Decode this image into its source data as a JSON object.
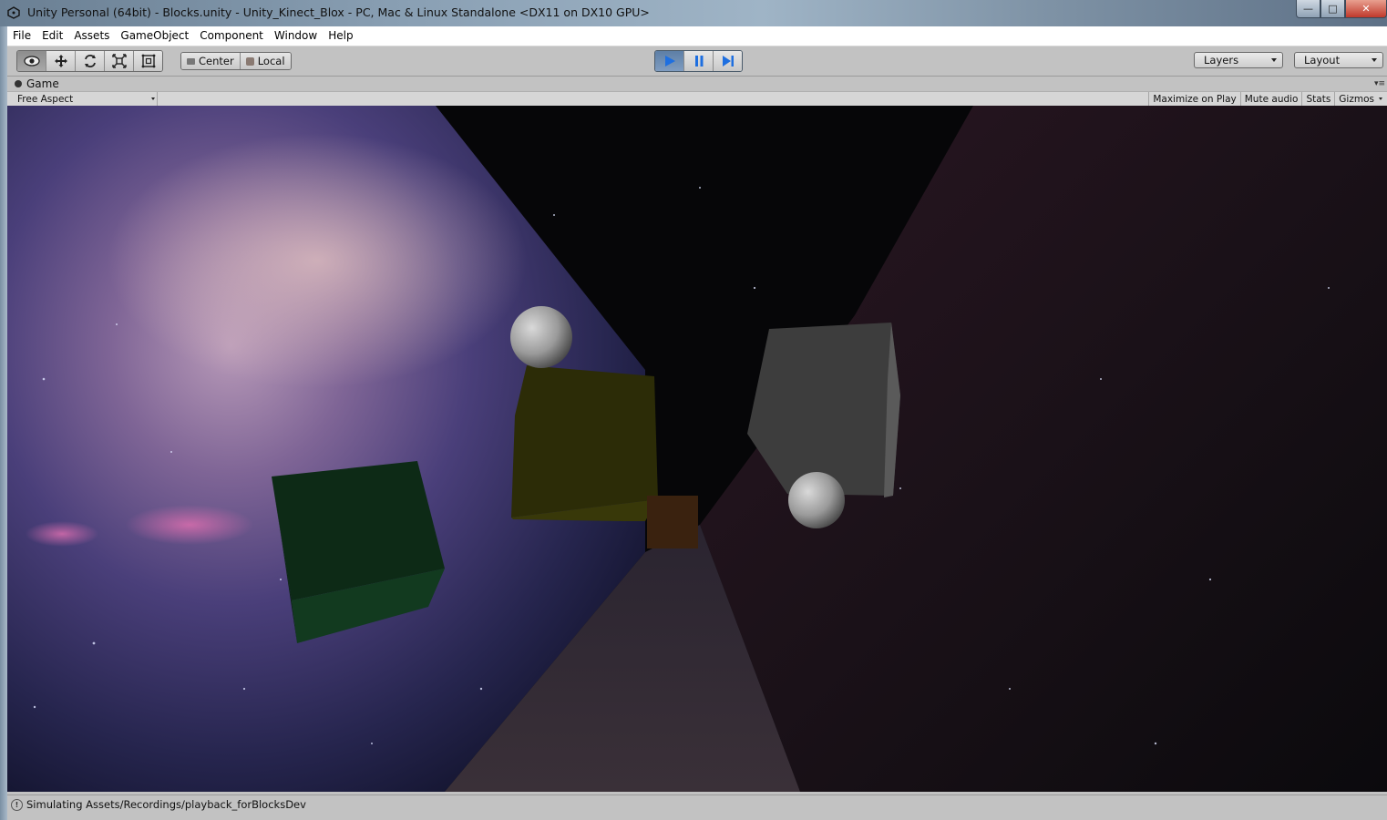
{
  "window": {
    "title": "Unity Personal (64bit) - Blocks.unity - Unity_Kinect_Blox - PC, Mac & Linux Standalone <DX11 on DX10 GPU>",
    "controls": {
      "minimize": "—",
      "maximize": "□",
      "close": "✕"
    }
  },
  "menu": [
    "File",
    "Edit",
    "Assets",
    "GameObject",
    "Component",
    "Window",
    "Help"
  ],
  "toolbar": {
    "tools": [
      "hand-tool",
      "move-tool",
      "rotate-tool",
      "scale-tool",
      "rect-tool"
    ],
    "active_tool": "hand-tool",
    "pivot_label": "Center",
    "space_label": "Local",
    "playing": true,
    "layers_label": "Layers",
    "layout_label": "Layout"
  },
  "game_view": {
    "tab_label": "Game",
    "aspect_label": "Free Aspect",
    "maximize_label": "Maximize on Play",
    "mute_label": "Mute audio",
    "stats_label": "Stats",
    "gizmos_label": "Gizmos"
  },
  "status": {
    "text": "Simulating Assets/Recordings/playback_forBlocksDev"
  },
  "colors": {
    "editor_bg": "#c2c2c2",
    "play_active": "#6f8fb5",
    "close_btn": "#c0392b"
  }
}
